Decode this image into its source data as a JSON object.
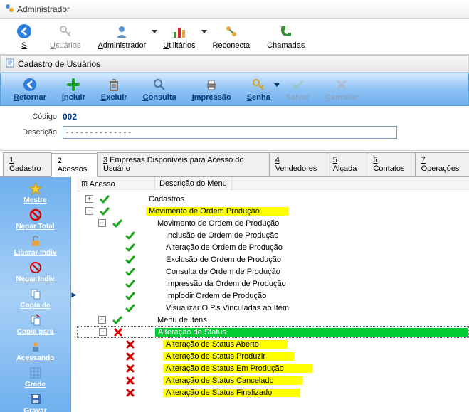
{
  "window": {
    "title": "Administrador"
  },
  "main_toolbar": {
    "sair": "Sair",
    "usuarios": "Usuários",
    "administrador": "Administrador",
    "utilitarios": "Utilitários",
    "reconecta": "Reconecta",
    "chamadas": "Chamadas"
  },
  "subwin": {
    "title": "Cadastro de Usuários"
  },
  "sub_toolbar": {
    "retornar": "Retornar",
    "incluir": "Incluir",
    "excluir": "Excluir",
    "consulta": "Consulta",
    "impressao": "Impressão",
    "senha": "Senha",
    "salvar": "Salvar",
    "cancelar": "Cancelar"
  },
  "form": {
    "codigo_label": "Código",
    "codigo_value": "002",
    "descricao_label": "Descrição",
    "descricao_value": "- - - - - - - - - - - - - -"
  },
  "tabs": {
    "t1": "1 Cadastro",
    "t2": "2 Acessos",
    "t3": "3 Empresas Disponíveis para Acesso do Usuário",
    "t4": "4 Vendedores",
    "t5": "5 Alçada",
    "t6": "6 Contatos",
    "t7": "7 Operações"
  },
  "sidebar": {
    "mestre": "Mestre",
    "negar_total": "Negar Total",
    "liberar_indiv": "Liberar Indiv",
    "negar_indiv": "Negar Indiv",
    "copia_de": "Copia de",
    "copia_para": "Copia para",
    "acessando": "Acessando",
    "grade": "Grade",
    "gravar": "Gravar"
  },
  "tree": {
    "header_acesso": "Acesso",
    "header_descricao": "Descrição do Menu",
    "rows": [
      {
        "indent": 0,
        "exp": "plus",
        "status": "check",
        "label": "Cadastros",
        "hl": ""
      },
      {
        "indent": 0,
        "exp": "minus",
        "status": "check",
        "label": "Movimento de Ordem Produção",
        "hl": "yellow"
      },
      {
        "indent": 1,
        "exp": "minus",
        "status": "check",
        "label": "Movimento de Ordem de Produção",
        "hl": ""
      },
      {
        "indent": 2,
        "exp": "none",
        "status": "check",
        "label": "Inclusão de Ordem de Produção",
        "hl": ""
      },
      {
        "indent": 2,
        "exp": "none",
        "status": "check",
        "label": "Alteração de Ordem de Produção",
        "hl": ""
      },
      {
        "indent": 2,
        "exp": "none",
        "status": "check",
        "label": "Exclusão de Ordem de Produção",
        "hl": ""
      },
      {
        "indent": 2,
        "exp": "none",
        "status": "check",
        "label": "Consulta de Ordem de Produção",
        "hl": ""
      },
      {
        "indent": 2,
        "exp": "none",
        "status": "check",
        "label": "Impressão da Ordem de Produção",
        "hl": ""
      },
      {
        "indent": 2,
        "exp": "none",
        "status": "check",
        "label": "Implodir Ordem de Produção",
        "hl": ""
      },
      {
        "indent": 2,
        "exp": "none",
        "status": "check",
        "label": "Visualizar O.P.s Vinculadas ao Item",
        "hl": ""
      },
      {
        "indent": 1,
        "exp": "plus",
        "status": "check",
        "label": "Menu de Itens",
        "hl": ""
      },
      {
        "indent": 1,
        "exp": "minus",
        "status": "x",
        "label": "Alteração de Status",
        "hl": "green",
        "sel": true
      },
      {
        "indent": 2,
        "exp": "none",
        "status": "x",
        "label": "Alteração de Status Aberto",
        "hl": "yellow"
      },
      {
        "indent": 2,
        "exp": "none",
        "status": "x",
        "label": "Alteração de Status Produzir",
        "hl": "yellow"
      },
      {
        "indent": 2,
        "exp": "none",
        "status": "x",
        "label": "Alteração de Status Em Produção",
        "hl": "yellow"
      },
      {
        "indent": 2,
        "exp": "none",
        "status": "x",
        "label": "Alteração de Status Cancelado",
        "hl": "yellow"
      },
      {
        "indent": 2,
        "exp": "none",
        "status": "x",
        "label": "Alteração de Status Finalizado",
        "hl": "yellow"
      }
    ]
  }
}
